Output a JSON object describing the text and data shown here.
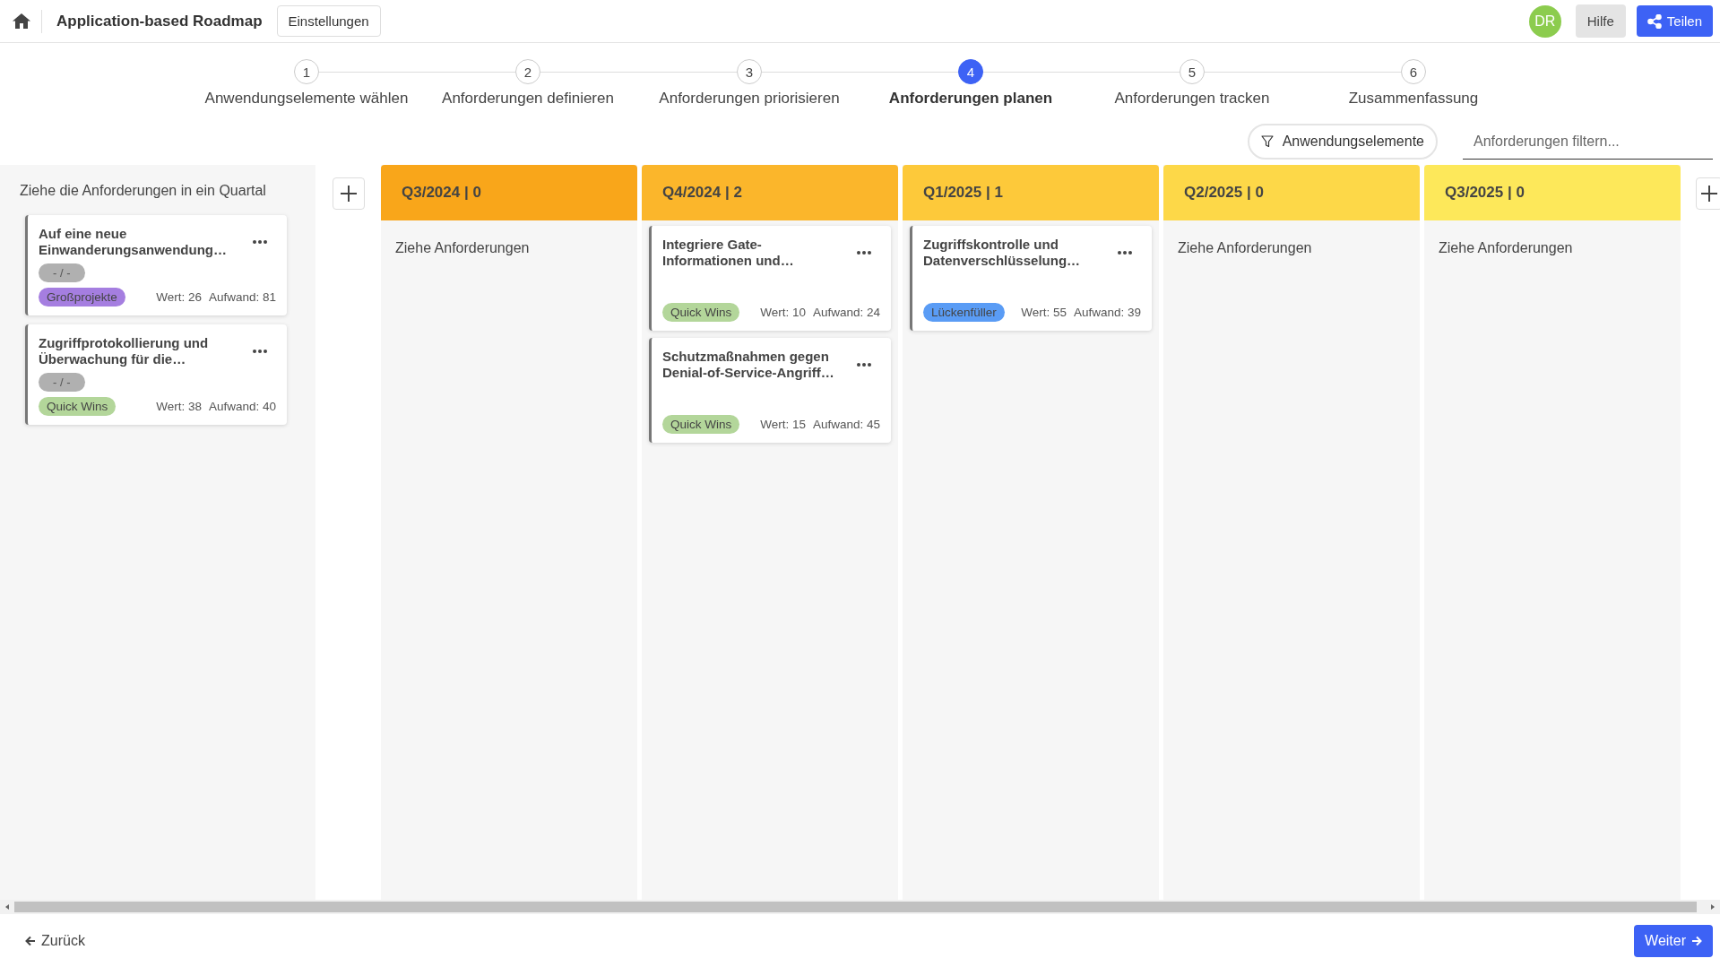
{
  "header": {
    "title": "Application-based Roadmap",
    "settings_button": "Einstellungen",
    "avatar": "DR",
    "help_button": "Hilfe",
    "share_button": "Teilen"
  },
  "steps": [
    {
      "number": "1",
      "label": "Anwendungselemente wählen",
      "selected": false
    },
    {
      "number": "2",
      "label": "Anforderungen definieren",
      "selected": false
    },
    {
      "number": "3",
      "label": "Anforderungen priorisieren",
      "selected": false
    },
    {
      "number": "4",
      "label": "Anforderungen planen",
      "selected": true
    },
    {
      "number": "5",
      "label": "Anforderungen tracken",
      "selected": false
    },
    {
      "number": "6",
      "label": "Zusammenfassung",
      "selected": false
    }
  ],
  "filter_button": "Anwendungselemente",
  "search": {
    "placeholder": "Anforderungen filtern..."
  },
  "backlog": {
    "hint": "Ziehe die Anforderungen in ein Quartal",
    "cards": [
      {
        "title": "Auf eine neue Einwanderungsanwendung…",
        "date": "- / -",
        "tag": "Großprojekte",
        "color": "#a57ee0",
        "value": "Wert: 26",
        "effort": "Aufwand: 81"
      },
      {
        "title": "Zugriffprotokollierung und Überwachung für die…",
        "date": "- / -",
        "tag": "Quick Wins",
        "color": "#b3d69a",
        "value": "Wert: 38",
        "effort": "Aufwand: 40"
      }
    ]
  },
  "columns": [
    {
      "title": "Q3/2024 | 0",
      "color": "#f9a61a",
      "placeholder": "Ziehe Anforderungen"
    },
    {
      "title": "Q4/2024 | 2",
      "color": "#fbb62b",
      "cards": [
        {
          "title": "Integriere Gate-Informationen und…",
          "tag": "Quick Wins",
          "color": "#b3d69a",
          "value": "Wert: 10",
          "effort": "Aufwand: 24"
        },
        {
          "title": "Schutzmaßnahmen gegen Denial-of-Service-Angriff…",
          "tag": "Quick Wins",
          "color": "#b3d69a",
          "value": "Wert: 15",
          "effort": "Aufwand: 45"
        }
      ]
    },
    {
      "title": "Q1/2025 | 1",
      "color": "#fdc93a",
      "cards": [
        {
          "title": "Zugriffskontrolle und Datenverschlüsselung…",
          "tag": "Lückenfüller",
          "color": "#5a9cf5",
          "value": "Wert: 55",
          "effort": "Aufwand: 39"
        }
      ]
    },
    {
      "title": "Q2/2025 | 0",
      "color": "#fdd848",
      "placeholder": "Ziehe Anforderungen"
    },
    {
      "title": "Q3/2025 | 0",
      "color": "#fde85a",
      "placeholder": "Ziehe Anforderungen"
    }
  ],
  "footer": {
    "back_button": "Zurück",
    "next_button": "Weiter"
  }
}
